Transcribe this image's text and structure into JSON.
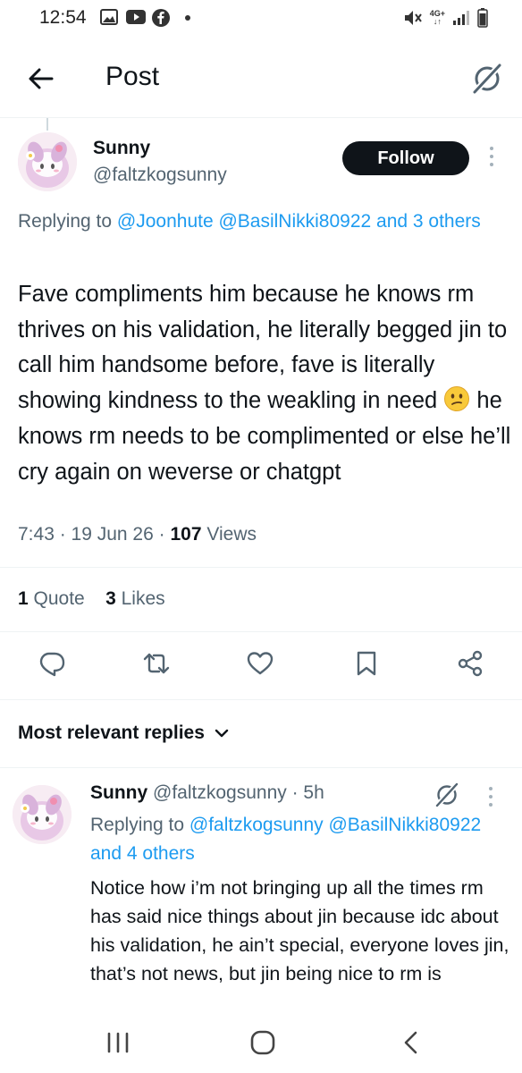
{
  "status_bar": {
    "time": "12:54",
    "icons": [
      "gallery-icon",
      "youtube-icon",
      "facebook-icon",
      "notification-dot",
      "mute-icon",
      "4g-icon",
      "signal-icon",
      "battery-icon"
    ],
    "network_top": "4G+",
    "network_bottom": "↓↑"
  },
  "header": {
    "title": "Post",
    "back_icon": "arrow-left-icon",
    "grok_icon": "grok-icon"
  },
  "tweet": {
    "author_name": "Sunny",
    "author_handle": "@faltzkogsunny",
    "follow_label": "Follow",
    "replying_prefix": "Replying to ",
    "replying_mentions": "@Joonhute @BasilNikki80922 and 3 others",
    "text_part1": "Fave compliments him because he knows rm thrives on his validation, he literally begged jin to call him handsome before, fave is literally showing kindness to the weakling in need ",
    "emoji": "confused-face-emoji",
    "text_part2": " he knows rm needs to be complimented or else he’ll cry again on weverse or chatgpt",
    "time": "7:43",
    "date": "19 Jun 26",
    "views_count": "107",
    "views_label": "Views",
    "quotes_count": "1",
    "quotes_label": "Quote",
    "likes_count": "3",
    "likes_label": "Likes"
  },
  "actions": [
    "reply-icon",
    "retweet-icon",
    "like-icon",
    "bookmark-icon",
    "share-icon"
  ],
  "replies_section": {
    "label": "Most relevant replies"
  },
  "reply": {
    "author_name": "Sunny",
    "author_handle": "@faltzkogsunny",
    "age": "5h",
    "replying_prefix": "Replying to ",
    "replying_mentions": "@faltzkogsunny @BasilNikki80922 and 4 others",
    "text": "Notice how i’m not bringing up all the times rm has said nice things about jin because idc about his validation, he ain’t special, everyone loves jin, that’s not news, but jin being nice to rm is"
  },
  "colors": {
    "text": "#0f1419",
    "secondary": "#536471",
    "link": "#1d9bf0",
    "follow_bg": "#0f1419",
    "divider": "#eff3f4",
    "icon": "#536471"
  },
  "nav_bar": [
    "recent-apps-icon",
    "home-icon",
    "back-icon"
  ]
}
